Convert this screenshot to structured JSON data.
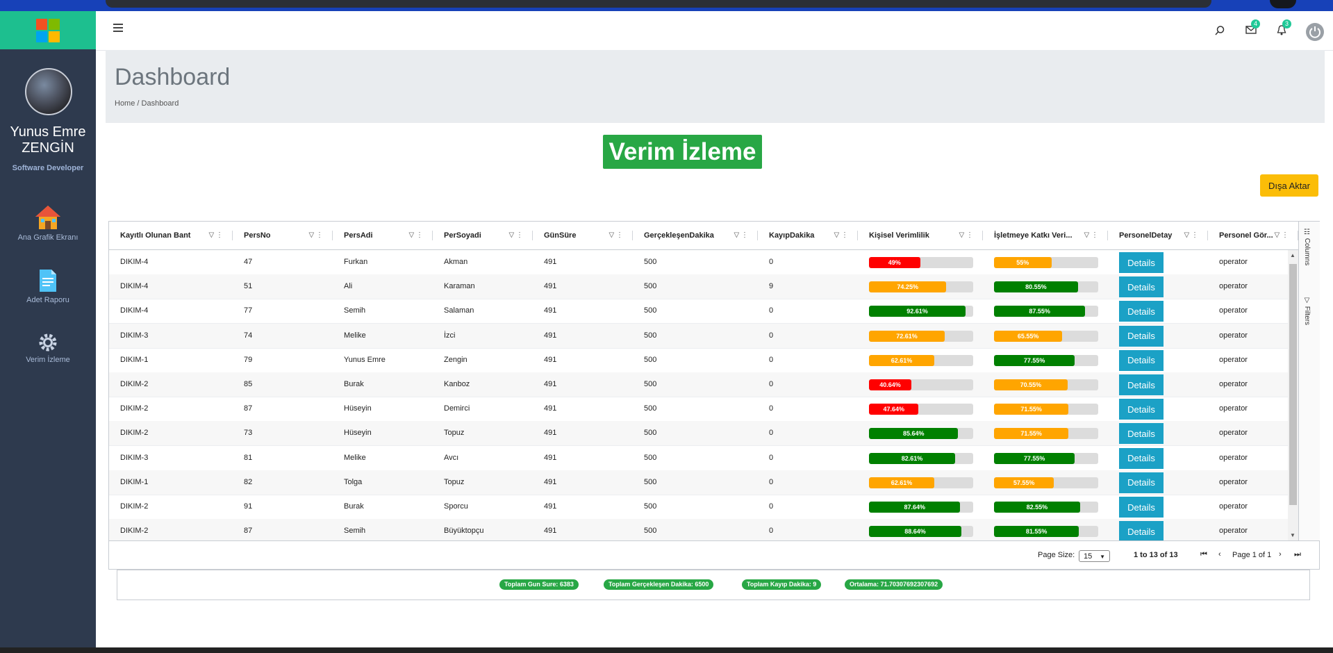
{
  "user": {
    "name": "Yunus Emre ZENGİN",
    "role": "Software Developer"
  },
  "sidebar": {
    "items": [
      {
        "label": "Ana Grafik Ekranı",
        "icon": "house-icon"
      },
      {
        "label": "Adet Raporu",
        "icon": "document-icon"
      },
      {
        "label": "Verim İzleme",
        "icon": "gear-icon"
      }
    ]
  },
  "topbar": {
    "mail_count": "4",
    "notification_count": "3"
  },
  "page": {
    "title": "Dashboard",
    "breadcrumb": "Home / Dashboard",
    "section_title": "Verim İzleme",
    "export_label": "Dışa Aktar"
  },
  "colors": {
    "green": "#28a745",
    "red": "#ff0000",
    "orange": "#ffa500",
    "darkgreen": "#008000",
    "teal": "#20c997",
    "sidebar": "#2e3a4e",
    "details": "#1ba1c6",
    "export": "#fbbd08"
  },
  "table": {
    "headers": [
      "Kayıtlı Olunan Bant",
      "PersNo",
      "PersAdi",
      "PerSoyadi",
      "GünSüre",
      "GerçekleşenDakika",
      "KayıpDakika",
      "Kişisel Verimlilik",
      "İşletmeye Katkı Veri...",
      "PersonelDetay",
      "Personel Gör..."
    ],
    "details_label": "Details",
    "rows": [
      {
        "bant": "DIKIM-4",
        "no": "47",
        "adi": "Furkan",
        "soyadi": "Akman",
        "sure": "491",
        "gercek": "500",
        "kayip": "0",
        "kv": "49%",
        "kv_pct": 49,
        "kv_color": "#ff0000",
        "ik": "55%",
        "ik_pct": 55,
        "ik_color": "#ffa500",
        "gorev": "operator"
      },
      {
        "bant": "DIKIM-4",
        "no": "51",
        "adi": "Ali",
        "soyadi": "Karaman",
        "sure": "491",
        "gercek": "500",
        "kayip": "9",
        "kv": "74.25%",
        "kv_pct": 74.25,
        "kv_color": "#ffa500",
        "ik": "80.55%",
        "ik_pct": 80.55,
        "ik_color": "#008000",
        "gorev": "operator"
      },
      {
        "bant": "DIKIM-4",
        "no": "77",
        "adi": "Semih",
        "soyadi": "Salaman",
        "sure": "491",
        "gercek": "500",
        "kayip": "0",
        "kv": "92.61%",
        "kv_pct": 92.61,
        "kv_color": "#008000",
        "ik": "87.55%",
        "ik_pct": 87.55,
        "ik_color": "#008000",
        "gorev": "operator"
      },
      {
        "bant": "DIKIM-3",
        "no": "74",
        "adi": "Melike",
        "soyadi": "İzci",
        "sure": "491",
        "gercek": "500",
        "kayip": "0",
        "kv": "72.61%",
        "kv_pct": 72.61,
        "kv_color": "#ffa500",
        "ik": "65.55%",
        "ik_pct": 65.55,
        "ik_color": "#ffa500",
        "gorev": "operator"
      },
      {
        "bant": "DIKIM-1",
        "no": "79",
        "adi": "Yunus Emre",
        "soyadi": "Zengin",
        "sure": "491",
        "gercek": "500",
        "kayip": "0",
        "kv": "62.61%",
        "kv_pct": 62.61,
        "kv_color": "#ffa500",
        "ik": "77.55%",
        "ik_pct": 77.55,
        "ik_color": "#008000",
        "gorev": "operator"
      },
      {
        "bant": "DIKIM-2",
        "no": "85",
        "adi": "Burak",
        "soyadi": "Kanboz",
        "sure": "491",
        "gercek": "500",
        "kayip": "0",
        "kv": "40.64%",
        "kv_pct": 40.64,
        "kv_color": "#ff0000",
        "ik": "70.55%",
        "ik_pct": 70.55,
        "ik_color": "#ffa500",
        "gorev": "operator"
      },
      {
        "bant": "DIKIM-2",
        "no": "87",
        "adi": "Hüseyin",
        "soyadi": "Demirci",
        "sure": "491",
        "gercek": "500",
        "kayip": "0",
        "kv": "47.64%",
        "kv_pct": 47.64,
        "kv_color": "#ff0000",
        "ik": "71.55%",
        "ik_pct": 71.55,
        "ik_color": "#ffa500",
        "gorev": "operator"
      },
      {
        "bant": "DIKIM-2",
        "no": "73",
        "adi": "Hüseyin",
        "soyadi": "Topuz",
        "sure": "491",
        "gercek": "500",
        "kayip": "0",
        "kv": "85.64%",
        "kv_pct": 85.64,
        "kv_color": "#008000",
        "ik": "71.55%",
        "ik_pct": 71.55,
        "ik_color": "#ffa500",
        "gorev": "operator"
      },
      {
        "bant": "DIKIM-3",
        "no": "81",
        "adi": "Melike",
        "soyadi": "Avcı",
        "sure": "491",
        "gercek": "500",
        "kayip": "0",
        "kv": "82.61%",
        "kv_pct": 82.61,
        "kv_color": "#008000",
        "ik": "77.55%",
        "ik_pct": 77.55,
        "ik_color": "#008000",
        "gorev": "operator"
      },
      {
        "bant": "DIKIM-1",
        "no": "82",
        "adi": "Tolga",
        "soyadi": "Topuz",
        "sure": "491",
        "gercek": "500",
        "kayip": "0",
        "kv": "62.61%",
        "kv_pct": 62.61,
        "kv_color": "#ffa500",
        "ik": "57.55%",
        "ik_pct": 57.55,
        "ik_color": "#ffa500",
        "gorev": "operator"
      },
      {
        "bant": "DIKIM-2",
        "no": "91",
        "adi": "Burak",
        "soyadi": "Sporcu",
        "sure": "491",
        "gercek": "500",
        "kayip": "0",
        "kv": "87.64%",
        "kv_pct": 87.64,
        "kv_color": "#008000",
        "ik": "82.55%",
        "ik_pct": 82.55,
        "ik_color": "#008000",
        "gorev": "operator"
      },
      {
        "bant": "DIKIM-2",
        "no": "87",
        "adi": "Semih",
        "soyadi": "Büyüktopçu",
        "sure": "491",
        "gercek": "500",
        "kayip": "0",
        "kv": "88.64%",
        "kv_pct": 88.64,
        "kv_color": "#008000",
        "ik": "81.55%",
        "ik_pct": 81.55,
        "ik_color": "#008000",
        "gorev": "operator"
      }
    ]
  },
  "side_panel": {
    "columns_label": "Columns",
    "filters_label": "Filters"
  },
  "pagination": {
    "page_size_label": "Page Size:",
    "page_size": "15",
    "range": "1 to 13 of 13",
    "page_info": "Page 1 of 1"
  },
  "summary": {
    "total_gun_sure": "Toplam Gun Sure: 6383",
    "total_gerceklesen": "Toplam Gerçekleşen Dakika: 6500",
    "total_kayip": "Toplam Kayıp Dakika: 9",
    "ortalama": "Ortalama: 71.70307692307692"
  }
}
